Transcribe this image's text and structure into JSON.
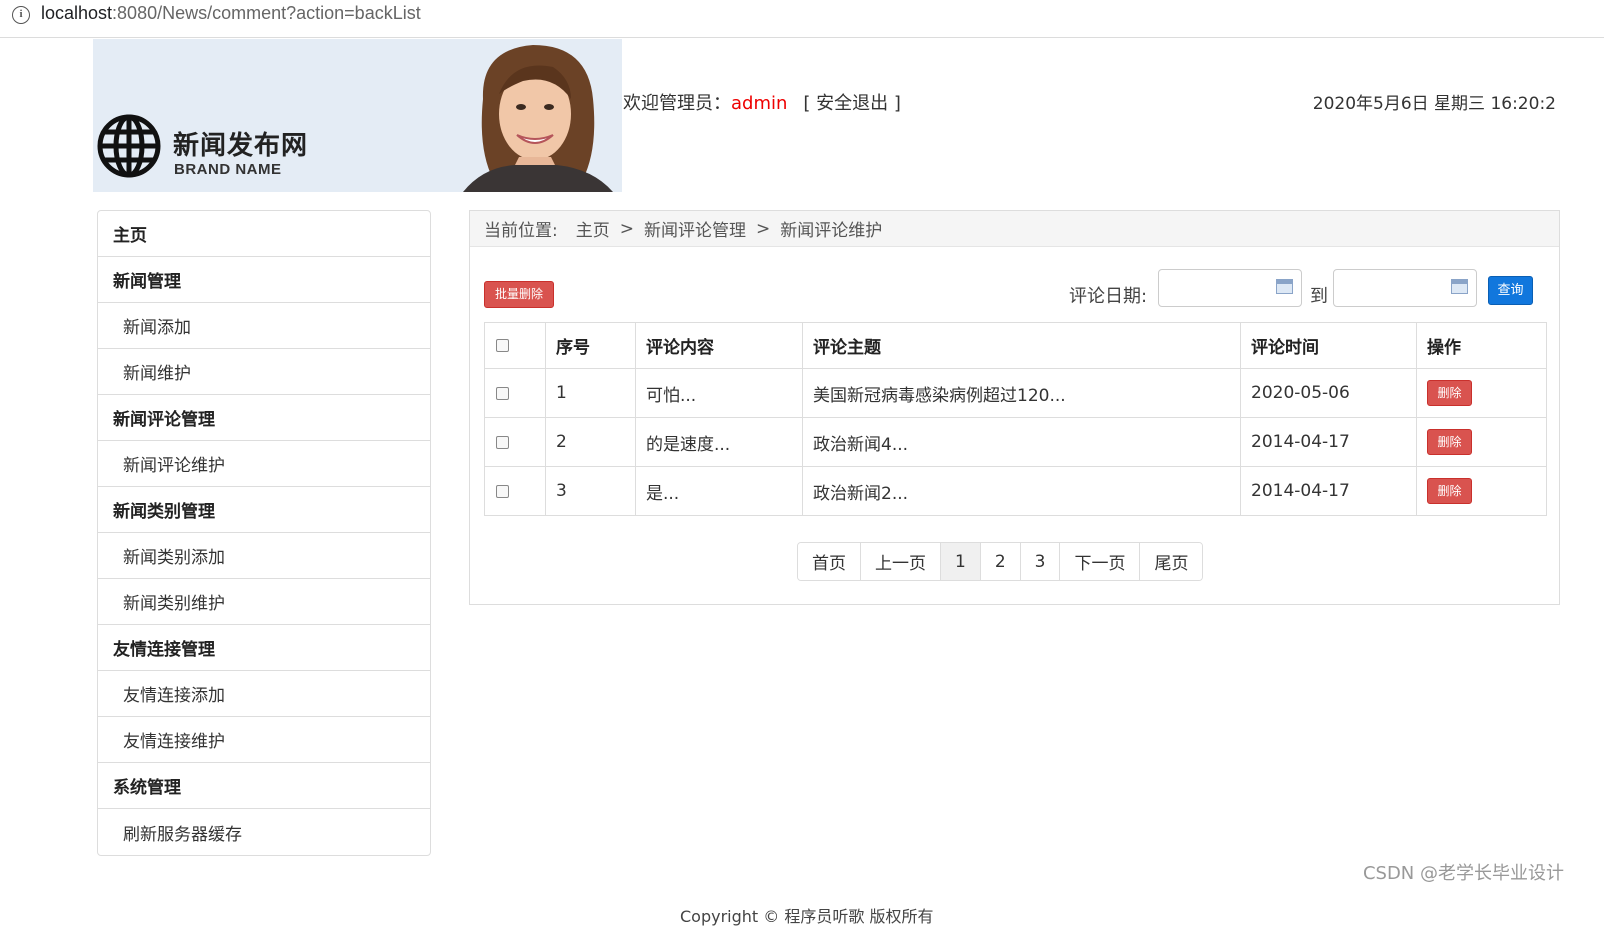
{
  "browser": {
    "url_host": "localhost",
    "url_rest": ":8080/News/comment?action=backList"
  },
  "banner": {
    "site_title": "新闻发布网",
    "brand_name": "BRAND NAME"
  },
  "header": {
    "welcome_label": "欢迎管理员：",
    "username": "admin",
    "logout_label": "[ 安全退出 ]",
    "datetime": "2020年5月6日 星期三 16:20:2"
  },
  "sidebar": {
    "items": [
      {
        "label": "主页",
        "type": "head"
      },
      {
        "label": "新闻管理",
        "type": "head"
      },
      {
        "label": "新闻添加",
        "type": "sub"
      },
      {
        "label": "新闻维护",
        "type": "sub"
      },
      {
        "label": "新闻评论管理",
        "type": "head"
      },
      {
        "label": "新闻评论维护",
        "type": "sub"
      },
      {
        "label": "新闻类别管理",
        "type": "head"
      },
      {
        "label": "新闻类别添加",
        "type": "sub"
      },
      {
        "label": "新闻类别维护",
        "type": "sub"
      },
      {
        "label": "友情连接管理",
        "type": "head"
      },
      {
        "label": "友情连接添加",
        "type": "sub"
      },
      {
        "label": "友情连接维护",
        "type": "sub"
      },
      {
        "label": "系统管理",
        "type": "head"
      },
      {
        "label": "刷新服务器缓存",
        "type": "sub"
      }
    ]
  },
  "breadcrumb": {
    "label": "当前位置:",
    "items": [
      "主页",
      "新闻评论管理",
      "新闻评论维护"
    ],
    "separator": ">"
  },
  "toolbar": {
    "batch_delete": "批量删除",
    "date_label": "评论日期:",
    "to_label": "到",
    "query_button": "查询"
  },
  "table": {
    "headers": [
      "序号",
      "评论内容",
      "评论主题",
      "评论时间",
      "操作"
    ],
    "rows": [
      {
        "no": "1",
        "content": "可怕...",
        "topic": "美国新冠病毒感染病例超过120...",
        "time": "2020-05-06",
        "action": "删除"
      },
      {
        "no": "2",
        "content": "的是速度...",
        "topic": "政治新闻4...",
        "time": "2014-04-17",
        "action": "删除"
      },
      {
        "no": "3",
        "content": "是...",
        "topic": "政治新闻2...",
        "time": "2014-04-17",
        "action": "删除"
      }
    ]
  },
  "pagination": {
    "first": "首页",
    "prev": "上一页",
    "pages": [
      "1",
      "2",
      "3"
    ],
    "current": "1",
    "next": "下一页",
    "last": "尾页"
  },
  "footer": {
    "partial_text": "Copyright © 程序员听歌 版权所有"
  },
  "watermark": "CSDN @老学长毕业设计"
}
